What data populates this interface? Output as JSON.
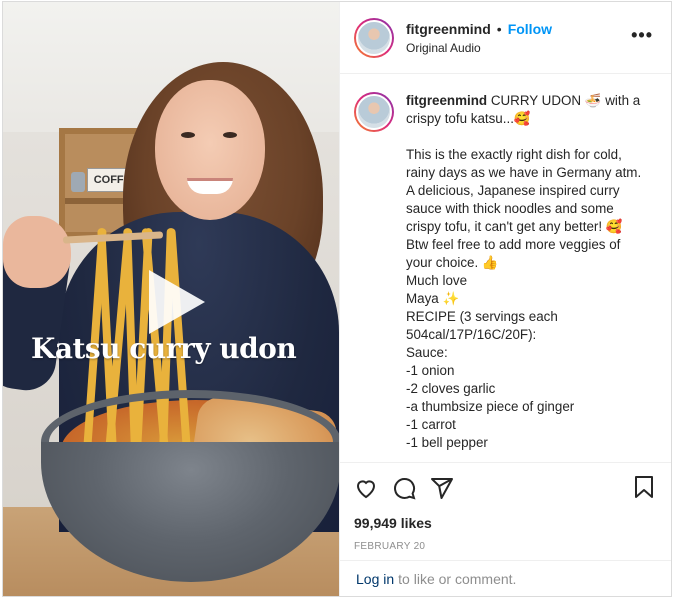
{
  "media": {
    "overlay_text": "Katsu curry udon",
    "shelf_label": "COFFEE"
  },
  "header": {
    "username": "fitgreenmind",
    "separator": "•",
    "follow_label": "Follow",
    "audio": "Original Audio",
    "more_label": "•••"
  },
  "caption": {
    "username": "fitgreenmind",
    "lines": [
      "CURRY UDON 🍜 with a crispy tofu katsu...🥰",
      "",
      "This is the exactly right dish for cold, rainy days as we have in Germany atm. A delicious, Japanese inspired curry sauce with thick noodles and some crispy tofu, it can't get any better! 🥰 Btw feel free to add more veggies of your choice. 👍",
      "Much love",
      "Maya ✨",
      "RECIPE (3 servings each 504cal/17P/16C/20F):",
      "Sauce:",
      "-1 onion",
      "-2 cloves garlic",
      "-a thumbsize piece of ginger",
      "-1 carrot",
      "-1 bell pepper"
    ]
  },
  "actions": {
    "like_icon": "heart-icon",
    "comment_icon": "comment-icon",
    "share_icon": "paper-plane-icon",
    "save_icon": "bookmark-icon"
  },
  "likes": "99,949 likes",
  "date": "FEBRUARY 20",
  "login": {
    "link": "Log in",
    "rest": "to like or comment."
  },
  "colors": {
    "link_blue": "#0095f6",
    "dark_link": "#00376b",
    "muted": "#8e8e8e"
  }
}
